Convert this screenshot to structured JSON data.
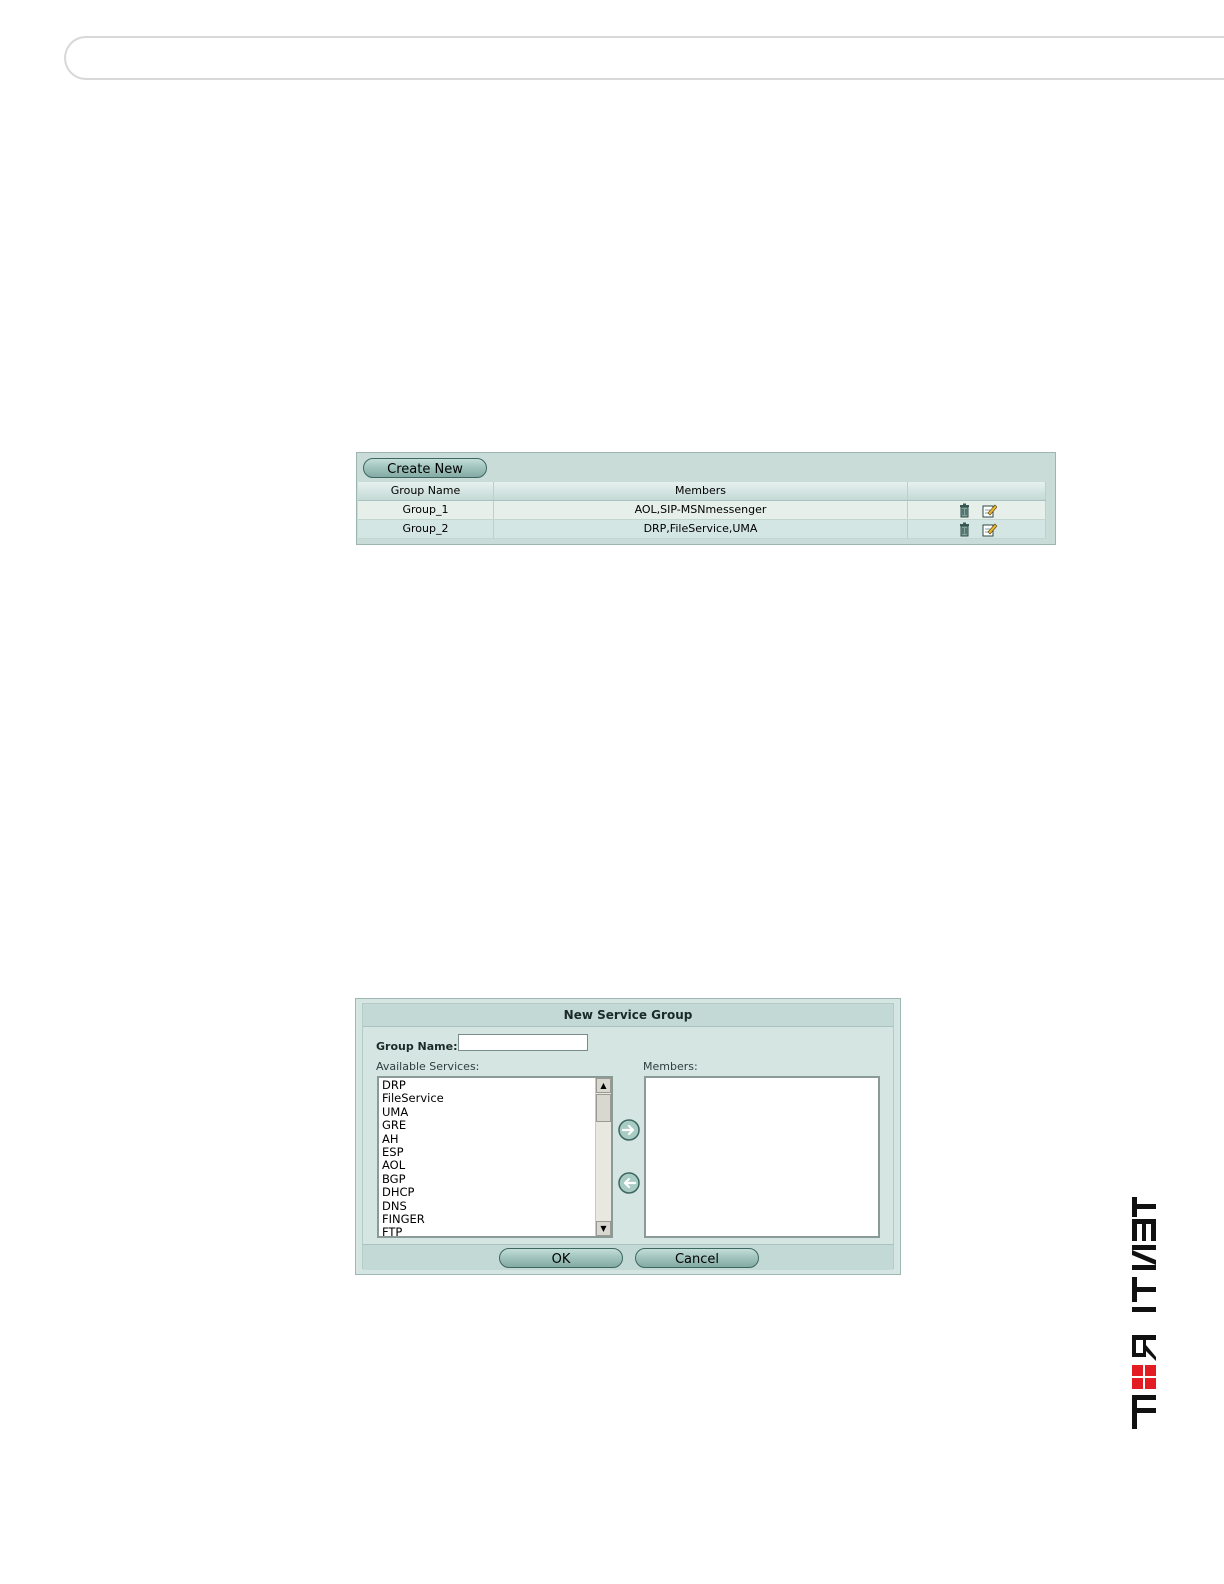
{
  "group_list": {
    "create_new_label": "Create New",
    "columns": [
      "Group Name",
      "Members",
      ""
    ],
    "rows": [
      {
        "name": "Group_1",
        "members": "AOL,SIP-MSNmessenger"
      },
      {
        "name": "Group_2",
        "members": "DRP,FileService,UMA"
      }
    ]
  },
  "dialog": {
    "title": "New Service Group",
    "group_name_label": "Group Name:",
    "group_name_value": "",
    "available_label": "Available Services:",
    "members_label": "Members:",
    "available_services": [
      "DRP",
      "FileService",
      "UMA",
      "GRE",
      "AH",
      "ESP",
      "AOL",
      "BGP",
      "DHCP",
      "DNS",
      "FINGER",
      "FTP"
    ],
    "ok_label": "OK",
    "cancel_label": "Cancel"
  },
  "icons": {
    "delete": "trash-icon",
    "edit": "edit-icon",
    "add": "arrow-right-icon",
    "remove": "arrow-left-icon"
  },
  "colors": {
    "panel_bg": "#c9dcd8",
    "button_fill": "#9fc2bc",
    "logo_red": "#e31b23"
  }
}
